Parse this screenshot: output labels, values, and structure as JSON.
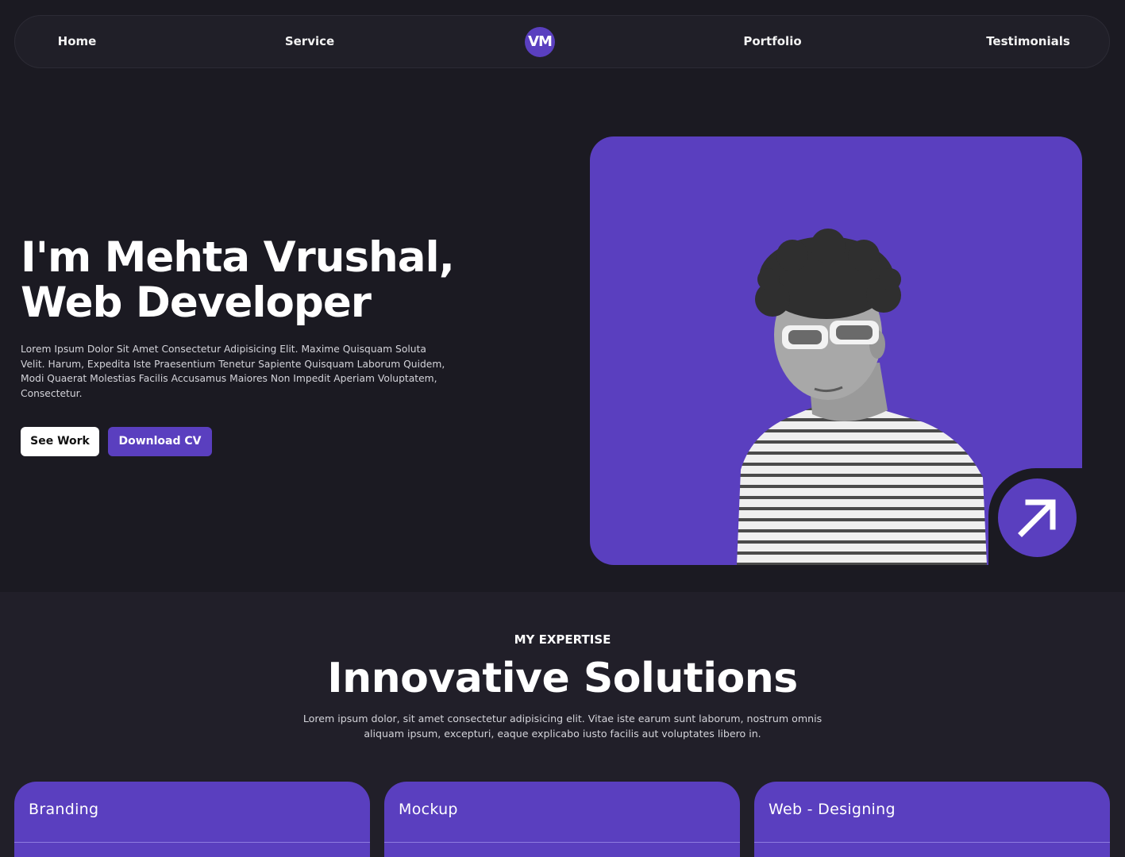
{
  "nav": {
    "items": [
      {
        "label": "Home"
      },
      {
        "label": "Service"
      },
      {
        "label": "Portfolio"
      },
      {
        "label": "Testimonials"
      }
    ],
    "logo": "VM"
  },
  "hero": {
    "title_line1": "I'm Mehta Vrushal,",
    "title_line2": "Web Developer",
    "description": "Lorem Ipsum Dolor Sit Amet Consectetur Adipisicing Elit. Maxime Quisquam Soluta Velit. Harum, Expedita Iste Praesentium Tenetur Sapiente Quisquam Laborum Quidem, Modi Quaerat Molestias Facilis Accusamus Maiores Non Impedit Aperiam Voluptatem, Consectetur.",
    "primary_button": "See Work",
    "secondary_button": "Download CV",
    "arrow_icon": "arrow-up-right-icon"
  },
  "expertise": {
    "eyebrow": "MY EXPERTISE",
    "title": "Innovative Solutions",
    "description": "Lorem ipsum dolor, sit amet consectetur adipisicing elit. Vitae iste earum sunt laborum, nostrum omnis aliquam ipsum, excepturi, eaque explicabo iusto facilis aut voluptates libero in.",
    "cards": [
      {
        "title": "Branding"
      },
      {
        "title": "Mockup"
      },
      {
        "title": "Web - Designing"
      }
    ]
  },
  "colors": {
    "background": "#1b1a22",
    "section_bg": "#211f29",
    "accent": "#5a3fbf",
    "nav_bg": "#201f28"
  }
}
